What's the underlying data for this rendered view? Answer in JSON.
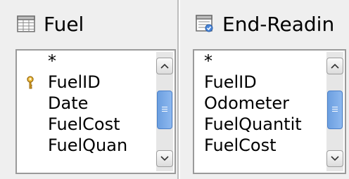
{
  "tables": [
    {
      "title": "Fuel",
      "title_icon": "table-icon",
      "fields": [
        "*",
        "FuelID",
        "Date",
        "FuelCost",
        "FuelQuan"
      ],
      "primary_key": "FuelID",
      "scroll": {
        "thumb_start": 0.22,
        "thumb_size": 0.5
      }
    },
    {
      "title": "End-Readin",
      "title_icon": "query-icon",
      "fields": [
        "*",
        "FuelID",
        "Odometer",
        "FuelQuantit",
        "FuelCost"
      ],
      "primary_key": "",
      "scroll": {
        "thumb_start": 0.22,
        "thumb_size": 0.5
      }
    }
  ],
  "icons": {
    "key": "key-icon",
    "scroll_up": "chevron-up-icon",
    "scroll_down": "chevron-down-icon"
  },
  "colors": {
    "thumb": "#7aaae8",
    "key": "#c89422",
    "panel_bg": "#efefef"
  }
}
